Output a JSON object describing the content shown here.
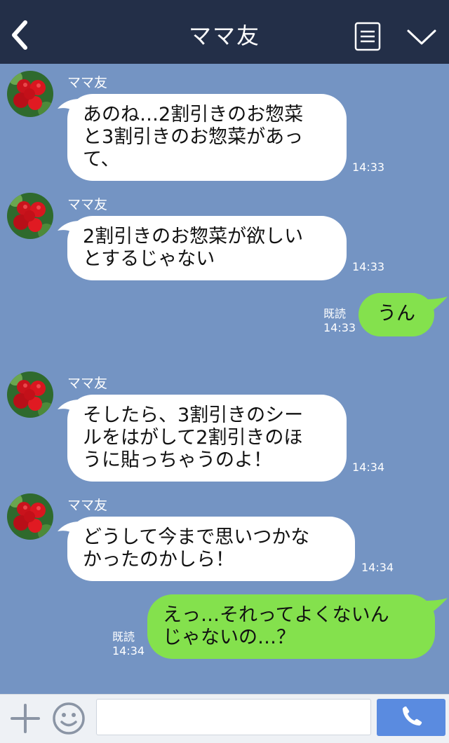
{
  "header": {
    "title": "ママ友"
  },
  "messages": [
    {
      "sender": "ママ友",
      "lines": [
        "あのね…2割引きのお惣菜",
        "と3割引きのお惣菜があっ",
        "て、"
      ],
      "time": "14:33"
    },
    {
      "sender": "ママ友",
      "lines": [
        "2割引きのお惣菜が欲しい",
        "とするじゃない"
      ],
      "time": "14:33"
    },
    {
      "lines": [
        "うん"
      ],
      "read": "既読",
      "time": "14:33"
    },
    {
      "sender": "ママ友",
      "lines": [
        "そしたら、3割引きのシー",
        "ルをはがして2割引きのほ",
        "うに貼っちゃうのよ！"
      ],
      "time": "14:34"
    },
    {
      "sender": "ママ友",
      "lines": [
        "どうして今まで思いつかな",
        "かったのかしら！"
      ],
      "time": "14:34"
    },
    {
      "lines": [
        "えっ…それってよくないん",
        "じゃないの…？"
      ],
      "read": "既読",
      "time": "14:34"
    }
  ],
  "colors": {
    "header_bg": "#232f48",
    "chat_bg": "#7494c3",
    "out_bubble": "#84e14d",
    "in_bubble": "#ffffff",
    "call_button": "#5a8be0"
  },
  "icons": [
    "back-arrow-icon",
    "menu-icon",
    "chevron-down-icon",
    "plus-icon",
    "emoji-icon",
    "phone-icon",
    "strawberry-avatar"
  ]
}
